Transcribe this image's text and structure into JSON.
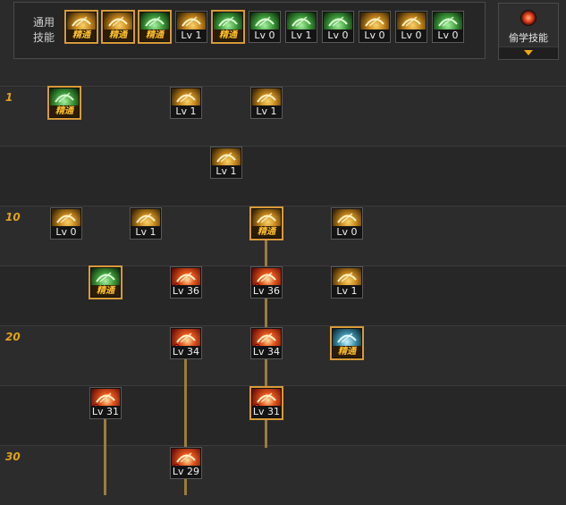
{
  "common_skills": {
    "label": "通用\n技能",
    "items": [
      {
        "badge": "精通",
        "elite": true,
        "color": "gold",
        "icon": "sitting-figure-icon"
      },
      {
        "badge": "精通",
        "elite": true,
        "color": "gold",
        "icon": "fist-strike-icon"
      },
      {
        "badge": "精通",
        "elite": true,
        "color": "green",
        "icon": "dash-figure-icon"
      },
      {
        "badge": "Lv 1",
        "elite": false,
        "color": "gold",
        "icon": "wings-icon"
      },
      {
        "badge": "精通",
        "elite": true,
        "color": "green",
        "icon": "target-burst-icon"
      },
      {
        "badge": "Lv 0",
        "elite": false,
        "color": "green",
        "icon": "gear-orb-icon"
      },
      {
        "badge": "Lv 1",
        "elite": false,
        "color": "green",
        "icon": "leap-figure-icon"
      },
      {
        "badge": "Lv 0",
        "elite": false,
        "color": "green",
        "icon": "fallen-figure-icon"
      },
      {
        "badge": "Lv 0",
        "elite": false,
        "color": "gold",
        "icon": "eye-ring-icon"
      },
      {
        "badge": "Lv 0",
        "elite": false,
        "color": "gold",
        "icon": "muscle-figure-icon"
      },
      {
        "badge": "Lv 0",
        "elite": false,
        "color": "green",
        "icon": "kick-figure-icon"
      }
    ]
  },
  "steal_skill": {
    "label": "偷学技能",
    "icon": "steal-orb-icon"
  },
  "level_markers": [
    "1",
    "10",
    "20",
    "30"
  ],
  "tree_skills": [
    {
      "badge": "精通",
      "elite": true,
      "color": "green",
      "icon": "sword-rune-icon",
      "mark": false
    },
    {
      "badge": "Lv 1",
      "elite": false,
      "color": "gold",
      "icon": "spear-thrust-icon",
      "mark": false
    },
    {
      "badge": "Lv 1",
      "elite": false,
      "color": "gold",
      "icon": "crescent-slash-icon",
      "mark": false
    },
    {
      "badge": "Lv 1",
      "elite": false,
      "color": "gold",
      "icon": "bow-arc-icon",
      "mark": false
    },
    {
      "badge": "Lv 0",
      "elite": false,
      "color": "gold",
      "icon": "swirl-slash-icon",
      "mark": false
    },
    {
      "badge": "Lv 1",
      "elite": false,
      "color": "gold",
      "icon": "lunge-figure-icon",
      "mark": false
    },
    {
      "badge": "精通",
      "elite": true,
      "color": "gold",
      "icon": "power-stance-icon",
      "mark": false
    },
    {
      "badge": "Lv 0",
      "elite": false,
      "color": "gold",
      "icon": "flame-spike-icon",
      "mark": false
    },
    {
      "badge": "精通",
      "elite": true,
      "color": "green",
      "icon": "leaf-blade-icon",
      "mark": false
    },
    {
      "badge": "Lv 36",
      "elite": false,
      "color": "red",
      "icon": "curved-slash-icon",
      "mark": true
    },
    {
      "badge": "Lv 36",
      "elite": false,
      "color": "red",
      "icon": "whirl-blade-icon",
      "mark": true
    },
    {
      "badge": "Lv 1",
      "elite": false,
      "color": "gold",
      "icon": "double-crescent-icon",
      "mark": false
    },
    {
      "badge": "Lv 34",
      "elite": false,
      "color": "red",
      "icon": "fire-wave-icon",
      "mark": true
    },
    {
      "badge": "Lv 34",
      "elite": false,
      "color": "red",
      "icon": "rising-slash-icon",
      "mark": true
    },
    {
      "badge": "精通",
      "elite": true,
      "color": "teal",
      "icon": "ice-shard-icon",
      "mark": false
    },
    {
      "badge": "Lv 31",
      "elite": false,
      "color": "red",
      "icon": "flame-warrior-icon",
      "mark": true
    },
    {
      "badge": "Lv 31",
      "elite": false,
      "color": "red",
      "icon": "burst-star-icon",
      "mark": true
    },
    {
      "badge": "Lv 29",
      "elite": false,
      "color": "red",
      "icon": "blast-strike-icon",
      "mark": true
    }
  ]
}
